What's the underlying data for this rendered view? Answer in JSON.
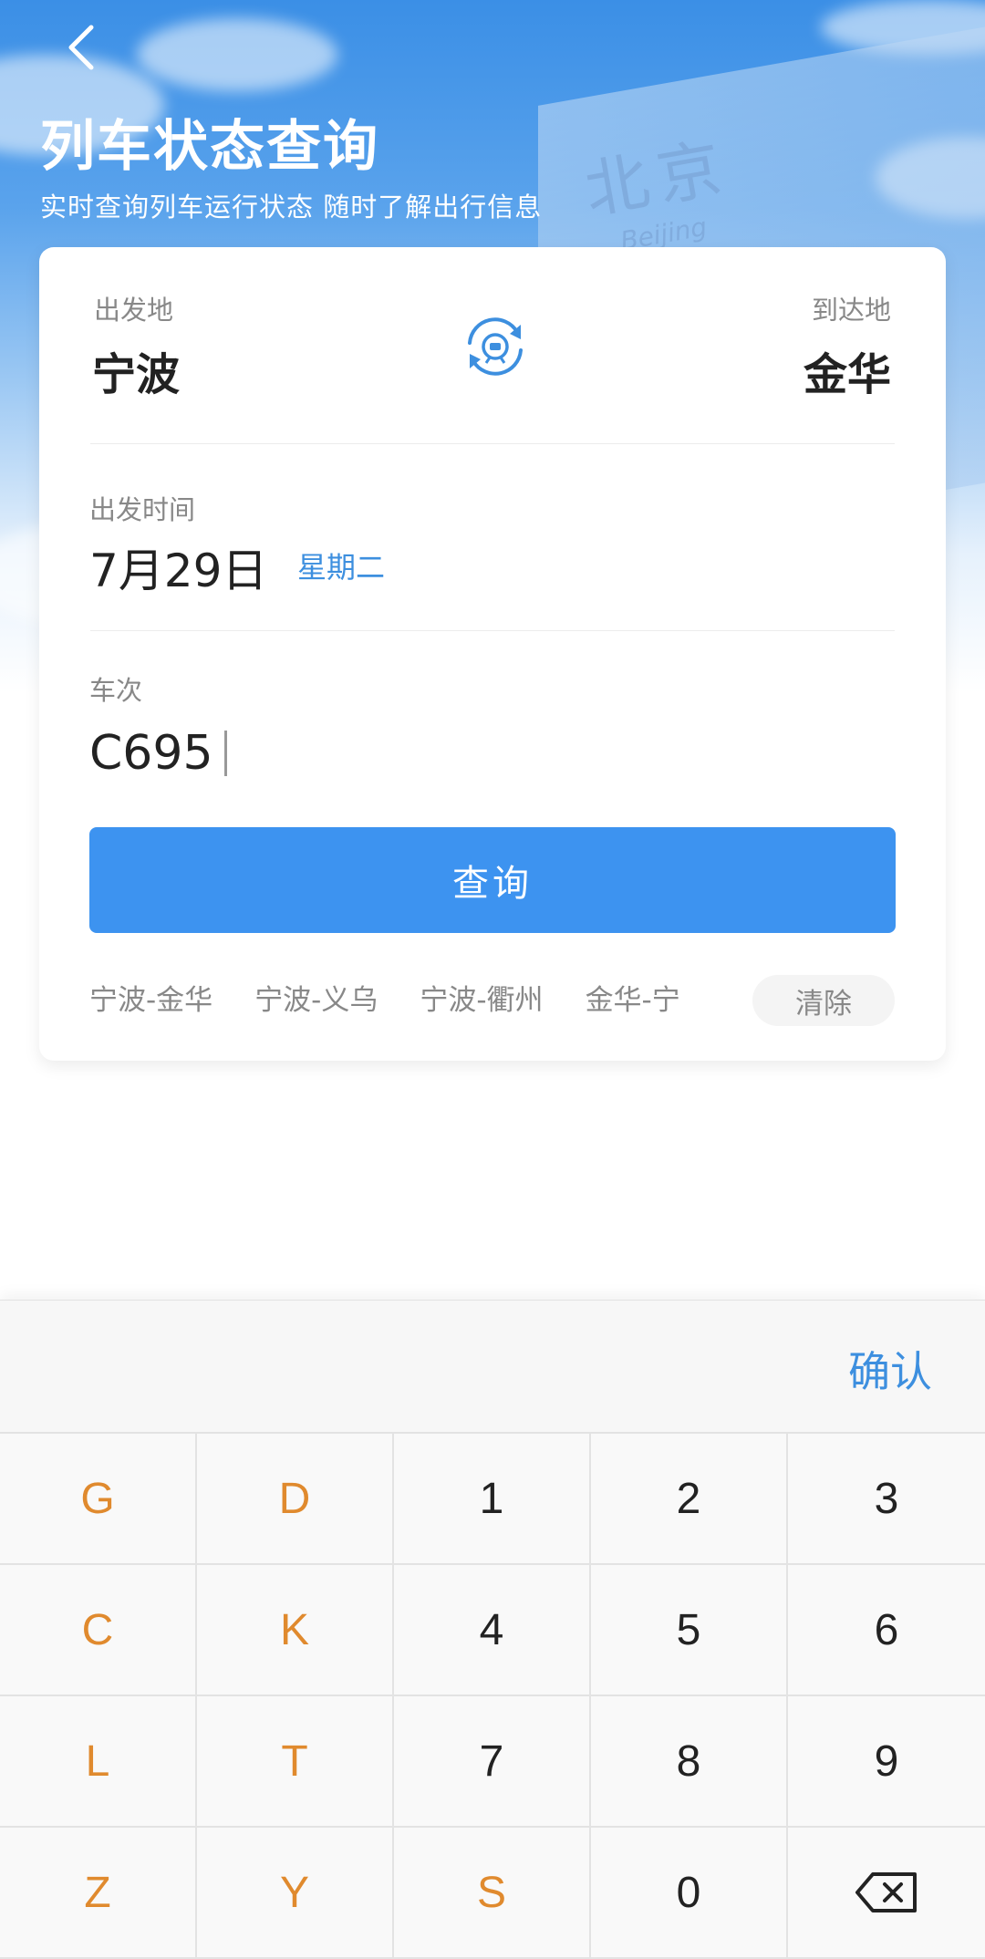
{
  "header": {
    "title": "列车状态查询",
    "subtitle": "实时查询列车运行状态 随时了解出行信息",
    "background_station_text": "北京",
    "background_station_sub": "Beijing"
  },
  "route": {
    "from_label": "出发地",
    "from_city": "宁波",
    "to_label": "到达地",
    "to_city": "金华"
  },
  "departure": {
    "label": "出发时间",
    "date": "7月29日",
    "weekday": "星期二"
  },
  "train": {
    "label": "车次",
    "value": "C695"
  },
  "query_button": "查询",
  "history": {
    "items": [
      "宁波-金华",
      "宁波-义乌",
      "宁波-衢州",
      "金华-宁"
    ],
    "clear_label": "清除"
  },
  "keyboard": {
    "confirm_label": "确认",
    "keys": [
      "G",
      "D",
      "1",
      "2",
      "3",
      "C",
      "K",
      "4",
      "5",
      "6",
      "L",
      "T",
      "7",
      "8",
      "9",
      "Z",
      "Y",
      "S",
      "0",
      "backspace"
    ]
  },
  "colors": {
    "accent": "#3d93f0",
    "letter_key": "#e08a2e"
  }
}
